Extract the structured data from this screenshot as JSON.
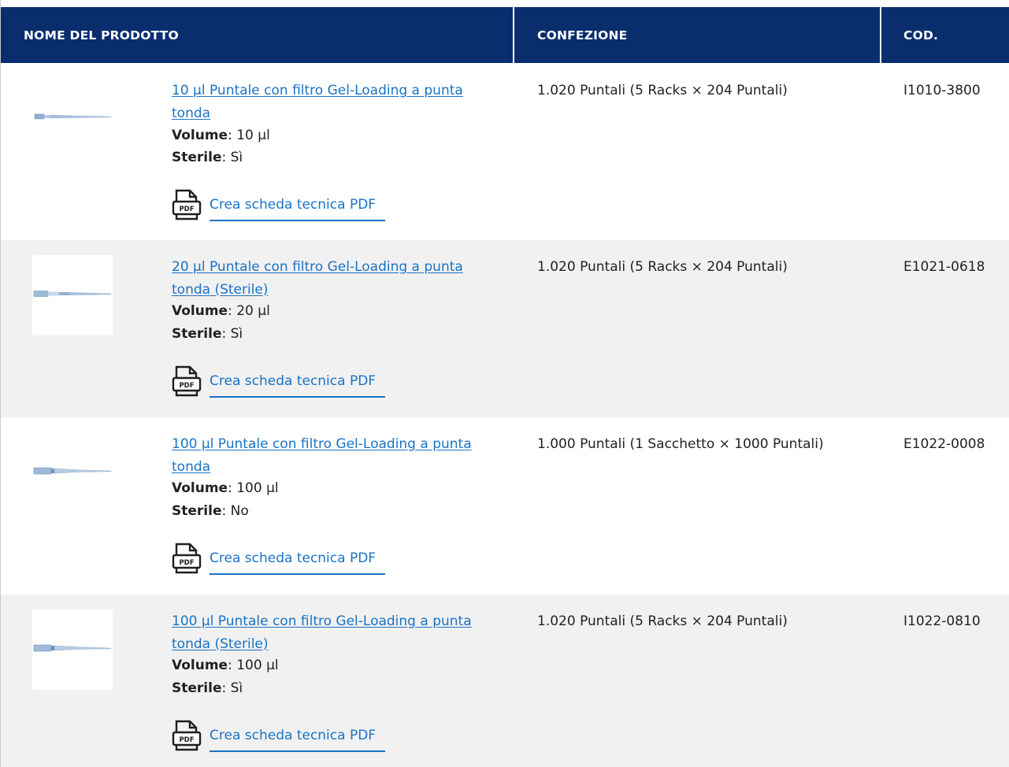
{
  "columns": {
    "name": "NOME DEL PRODOTTO",
    "pack": "CONFEZIONE",
    "code": "COD."
  },
  "labels": {
    "volume": "Volume",
    "sterile": "Sterile",
    "pdf": "Crea scheda tecnica PDF",
    "pdf_icon_text": "PDF"
  },
  "rows": [
    {
      "title": "10 µl Puntale con filtro Gel-Loading a punta tonda",
      "volume": "10 µl",
      "sterile": "Sì",
      "pack": "1.020 Puntali (5 Racks × 204 Puntali)",
      "code": "I1010-3800"
    },
    {
      "title": "20 µl Puntale con filtro Gel-Loading a punta tonda (Sterile)",
      "volume": "20 µl",
      "sterile": "Sì",
      "pack": "1.020 Puntali (5 Racks × 204 Puntali)",
      "code": "E1021-0618"
    },
    {
      "title": "100 µl Puntale con filtro Gel-Loading a punta tonda",
      "volume": "100 µl",
      "sterile": "No",
      "pack": "1.000 Puntali (1 Sacchetto × 1000 Puntali)",
      "code": "E1022-0008"
    },
    {
      "title": "100 µl Puntale con filtro Gel-Loading a punta tonda (Sterile)",
      "volume": "100 µl",
      "sterile": "Sì",
      "pack": "1.020 Puntali (5 Racks × 204 Puntali)",
      "code": "I1022-0810"
    }
  ],
  "colors": {
    "header_bg": "#0a2d6e",
    "link": "#1a73c4",
    "alt_row": "#f1f1f1"
  },
  "icons": [
    "pipette-tip-image",
    "pdf-file-icon"
  ]
}
